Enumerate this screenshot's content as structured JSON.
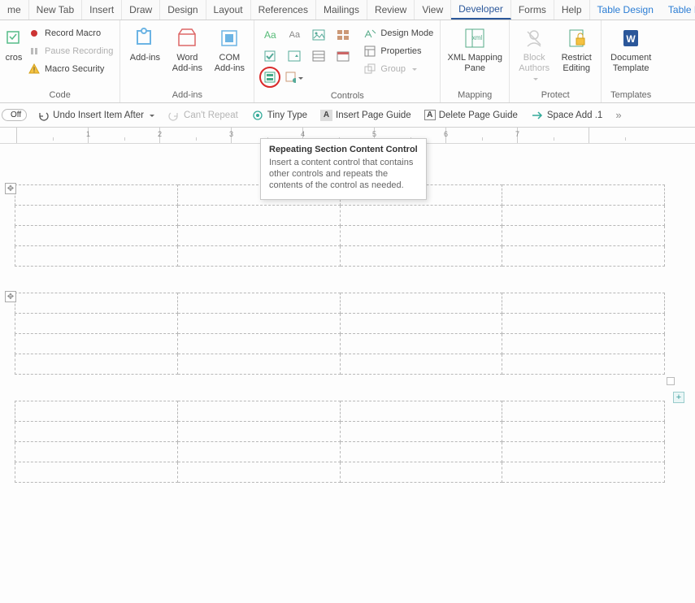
{
  "tabs": {
    "items": [
      "me",
      "New Tab",
      "Insert",
      "Draw",
      "Design",
      "Layout",
      "References",
      "Mailings",
      "Review",
      "View",
      "Developer",
      "Forms",
      "Help"
    ],
    "active": "Developer",
    "contextual": [
      "Table Design",
      "Table Layout"
    ]
  },
  "ribbon": {
    "code": {
      "macros": "cros",
      "record": "Record Macro",
      "pause": "Pause Recording",
      "security": "Macro Security",
      "label": "Code"
    },
    "addins": {
      "addins": "Add-ins",
      "word": "Word\nAdd-ins",
      "com": "COM\nAdd-ins",
      "label": "Add-ins"
    },
    "controls": {
      "design": "Design Mode",
      "properties": "Properties",
      "group": "Group",
      "label": "Controls"
    },
    "mapping": {
      "xml": "XML Mapping\nPane",
      "label": "Mapping"
    },
    "protect": {
      "block": "Block\nAuthors",
      "restrict": "Restrict\nEditing",
      "label": "Protect"
    },
    "templates": {
      "doc": "Document\nTemplate",
      "label": "Templates"
    }
  },
  "qat": {
    "off": "Off",
    "undo": "Undo Insert Item After",
    "repeat": "Can't Repeat",
    "tiny": "Tiny Type",
    "ipg": "Insert Page Guide",
    "dpg": "Delete Page Guide",
    "space": "Space Add .1",
    "more": "»"
  },
  "ruler": {
    "marks": [
      "",
      "1",
      "2",
      "3",
      "4",
      "5",
      "6",
      "7"
    ]
  },
  "tooltip": {
    "title": "Repeating Section Content Control",
    "body": "Insert a content control that contains other controls and repeats the contents of the control as needed."
  },
  "tables": {
    "cols": 4,
    "rows_per_block": 4,
    "blocks": 3
  }
}
